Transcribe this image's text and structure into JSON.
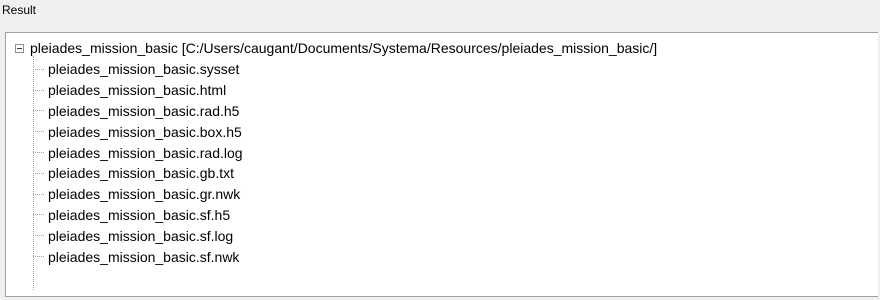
{
  "panel": {
    "label": "Result"
  },
  "tree": {
    "root": {
      "label": "pleiades_mission_basic [C:/Users/caugant/Documents/Systema/Resources/pleiades_mission_basic/]",
      "expanded": true
    },
    "children": [
      {
        "label": "pleiades_mission_basic.sysset"
      },
      {
        "label": "pleiades_mission_basic.html"
      },
      {
        "label": "pleiades_mission_basic.rad.h5"
      },
      {
        "label": "pleiades_mission_basic.box.h5"
      },
      {
        "label": "pleiades_mission_basic.rad.log"
      },
      {
        "label": "pleiades_mission_basic.gb.txt"
      },
      {
        "label": "pleiades_mission_basic.gr.nwk"
      },
      {
        "label": "pleiades_mission_basic.sf.h5"
      },
      {
        "label": "pleiades_mission_basic.sf.log"
      },
      {
        "label": "pleiades_mission_basic.sf.nwk"
      }
    ]
  },
  "icons": {
    "collapse": "collapse-minus-icon"
  }
}
